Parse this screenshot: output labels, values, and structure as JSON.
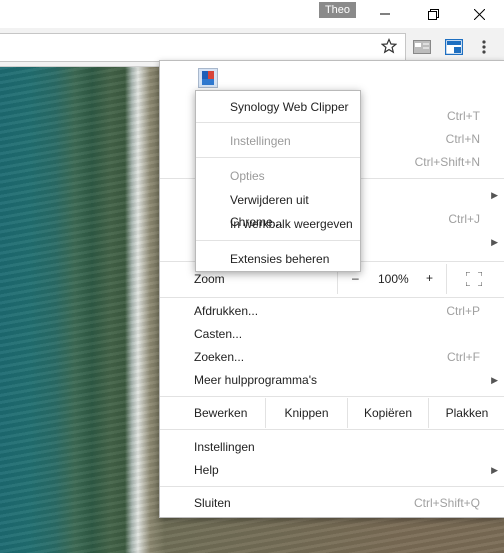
{
  "titlebar": {
    "profile_name": "Theo",
    "minimize_icon": "minimize-icon",
    "maximize_icon": "restore-icon",
    "close_icon": "close-icon"
  },
  "toolbar": {
    "star_icon": "bookmark-star-icon",
    "ext1_icon": "extension-card-icon",
    "ext2_icon": "synology-clipper-icon",
    "menu_icon": "chrome-menu-icon"
  },
  "popup": {
    "items": [
      {
        "label": "Synology Web Clipper",
        "enabled": true
      },
      {
        "label": "Instellingen",
        "enabled": false
      },
      {
        "label": "Opties",
        "enabled": false
      },
      {
        "label": "Verwijderen uit Chrome...",
        "enabled": true
      },
      {
        "label": "In werkbalk weergeven",
        "enabled": true
      },
      {
        "label": "Extensies beheren",
        "enabled": true
      }
    ]
  },
  "menu": {
    "shortcuts_top": [
      "Ctrl+T",
      "Ctrl+N",
      "Ctrl+Shift+N"
    ],
    "shortcut_history": "Ctrl+J",
    "zoom": {
      "label": "Zoom",
      "minus": "–",
      "value": "100%",
      "plus": "+",
      "fullscreen_icon": "fullscreen-icon"
    },
    "items_mid": [
      {
        "label": "Afdrukken...",
        "shortcut": "Ctrl+P"
      },
      {
        "label": "Casten...",
        "shortcut": ""
      },
      {
        "label": "Zoeken...",
        "shortcut": "Ctrl+F"
      },
      {
        "label": "Meer hulpprogramma's",
        "shortcut": "",
        "submenu": true
      }
    ],
    "edit": {
      "label": "Bewerken",
      "cut": "Knippen",
      "copy": "Kopiëren",
      "paste": "Plakken"
    },
    "items_bottom": [
      {
        "label": "Instellingen",
        "shortcut": ""
      },
      {
        "label": "Help",
        "shortcut": "",
        "submenu": true
      }
    ],
    "exit": {
      "label": "Sluiten",
      "shortcut": "Ctrl+Shift+Q"
    }
  }
}
